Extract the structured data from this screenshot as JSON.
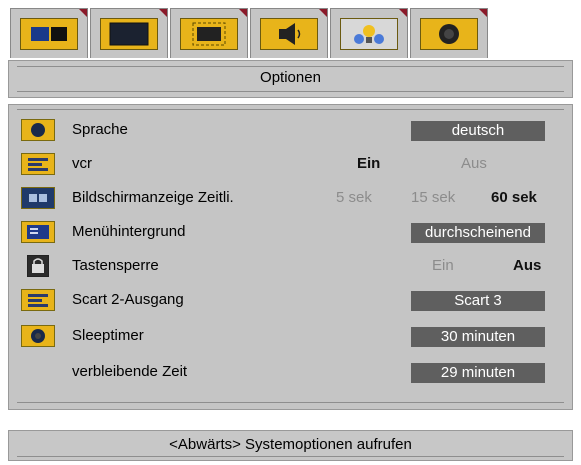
{
  "tabs": [
    {
      "icon": "picture-settings-icon"
    },
    {
      "icon": "screen-icon"
    },
    {
      "icon": "geometry-icon"
    },
    {
      "icon": "sound-icon"
    },
    {
      "icon": "features-icon"
    },
    {
      "icon": "options-icon"
    }
  ],
  "title": "Optionen",
  "rows": {
    "sprache": {
      "label": "Sprache",
      "value": "deutsch",
      "icon": "language-icon"
    },
    "vcr": {
      "label": "vcr",
      "opt_on": "Ein",
      "opt_off": "Aus",
      "selected": "Ein",
      "icon": "vcr-icon"
    },
    "osd": {
      "label": "Bildschirmanzeige Zeitli.",
      "opt1": "5 sek",
      "opt2": "15 sek",
      "opt3": "60 sek",
      "selected": "60 sek",
      "icon": "osd-timer-icon"
    },
    "menubg": {
      "label": "Menühintergrund",
      "value": "durchscheinend",
      "icon": "menu-background-icon"
    },
    "lock": {
      "label": "Tastensperre",
      "opt_on": "Ein",
      "opt_off": "Aus",
      "selected": "Aus",
      "icon": "lock-icon"
    },
    "scart": {
      "label": "Scart 2-Ausgang",
      "value": "Scart 3",
      "icon": "scart-icon"
    },
    "sleep": {
      "label": "Sleeptimer",
      "value": "30  minuten",
      "icon": "sleep-timer-icon"
    },
    "remaining": {
      "label": "verbleibende Zeit",
      "value": "29  minuten"
    }
  },
  "footer": "<Abwärts> Systemoptionen aufrufen",
  "colors": {
    "accent": "#e8b41a",
    "panel": "#c5c5c5",
    "value_box": "#5f5f5f"
  }
}
